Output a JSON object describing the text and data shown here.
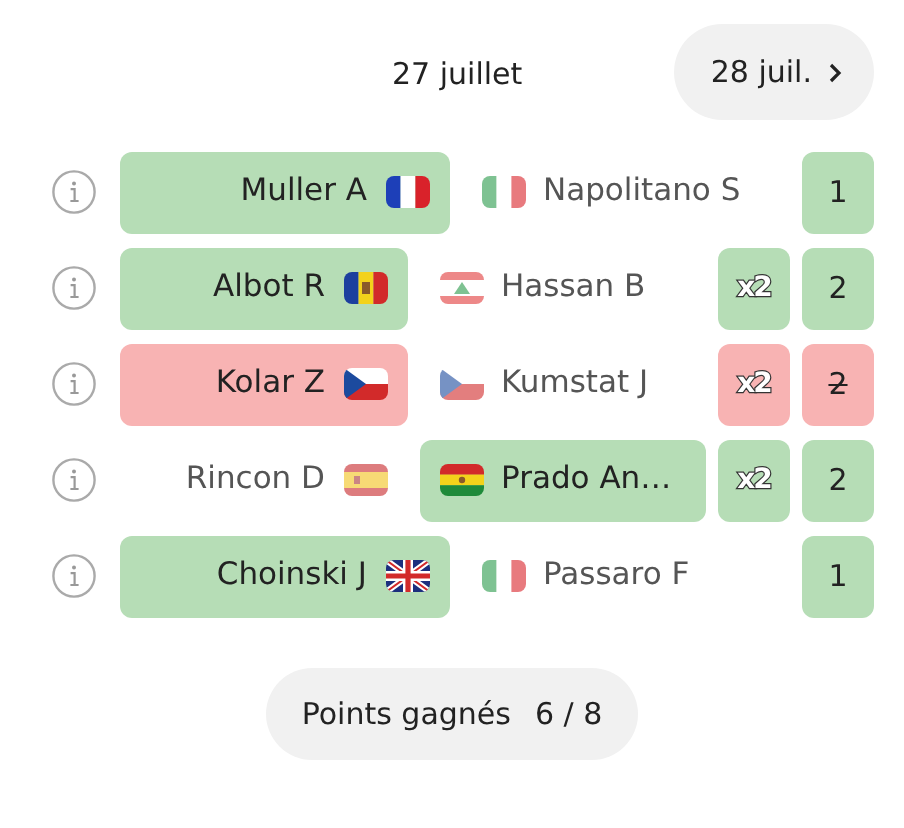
{
  "date_nav": {
    "current": "27 juillet",
    "next": "28 juil."
  },
  "matches": [
    {
      "home": {
        "name": "Muller A",
        "selected": true,
        "flag": {
          "kind": "fr"
        }
      },
      "away": {
        "name": "Napolitano S",
        "selected": false,
        "flag": {
          "kind": "it"
        }
      },
      "won": true,
      "points": "1"
    },
    {
      "home": {
        "name": "Albot R",
        "selected": true,
        "flag": {
          "kind": "md"
        }
      },
      "away": {
        "name": "Hassan B",
        "selected": false,
        "flag": {
          "kind": "lb"
        }
      },
      "won": true,
      "multiplier": "x2",
      "points": "2"
    },
    {
      "home": {
        "name": "Kolar Z",
        "selected": true,
        "flag": {
          "kind": "cz"
        }
      },
      "away": {
        "name": "Kumstat J",
        "selected": false,
        "flag": {
          "kind": "cz"
        }
      },
      "won": false,
      "multiplier": "x2",
      "points": "2"
    },
    {
      "home": {
        "name": "Rincon D",
        "selected": false,
        "flag": {
          "kind": "es"
        }
      },
      "away": {
        "name": "Prado An…",
        "selected": true,
        "flag": {
          "kind": "bo"
        }
      },
      "won": true,
      "multiplier": "x2",
      "points": "2"
    },
    {
      "home": {
        "name": "Choinski J",
        "selected": true,
        "flag": {
          "kind": "gb"
        }
      },
      "away": {
        "name": "Passaro F",
        "selected": false,
        "flag": {
          "kind": "it"
        }
      },
      "won": true,
      "points": "1"
    }
  ],
  "summary": {
    "label": "Points gagnés",
    "value": "6 / 8"
  }
}
